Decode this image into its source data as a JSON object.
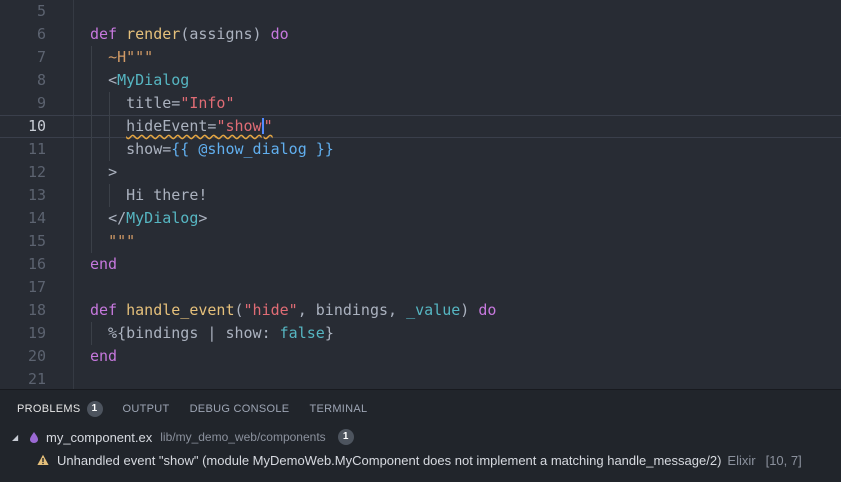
{
  "editor": {
    "lines": [
      {
        "n": "5",
        "tokens": []
      },
      {
        "n": "6",
        "tokens": [
          [
            "kw",
            "def"
          ],
          [
            "txt",
            " "
          ],
          [
            "fn",
            "render"
          ],
          [
            "punct",
            "(assigns) "
          ],
          [
            "kw",
            "do"
          ]
        ]
      },
      {
        "n": "7",
        "tokens": [
          [
            "txt",
            "  "
          ],
          [
            "sigil",
            "~H"
          ],
          [
            "heredoc",
            "\"\"\""
          ]
        ]
      },
      {
        "n": "8",
        "tokens": [
          [
            "txt",
            "  "
          ],
          [
            "punct",
            "<"
          ],
          [
            "comp",
            "MyDialog"
          ]
        ]
      },
      {
        "n": "9",
        "tokens": [
          [
            "txt",
            "    "
          ],
          [
            "attr",
            "title="
          ],
          [
            "val",
            "\"Info\""
          ]
        ]
      },
      {
        "n": "10",
        "tokens": [
          [
            "txt",
            "    "
          ],
          [
            "attr",
            "hideEvent="
          ],
          [
            "val",
            "\"show"
          ],
          [
            "cursor",
            ""
          ],
          [
            "val",
            "\""
          ]
        ]
      },
      {
        "n": "11",
        "tokens": [
          [
            "txt",
            "    "
          ],
          [
            "attr",
            "show="
          ],
          [
            "bind",
            "{{ @show_dialog }}"
          ]
        ]
      },
      {
        "n": "12",
        "tokens": [
          [
            "txt",
            "  "
          ],
          [
            "punct",
            ">"
          ]
        ]
      },
      {
        "n": "13",
        "tokens": [
          [
            "txt",
            "    Hi there!"
          ]
        ]
      },
      {
        "n": "14",
        "tokens": [
          [
            "txt",
            "  "
          ],
          [
            "punct",
            "</"
          ],
          [
            "comp",
            "MyDialog"
          ],
          [
            "punct",
            ">"
          ]
        ]
      },
      {
        "n": "15",
        "tokens": [
          [
            "txt",
            "  "
          ],
          [
            "heredoc",
            "\"\"\""
          ]
        ]
      },
      {
        "n": "16",
        "tokens": [
          [
            "kw",
            "end"
          ]
        ]
      },
      {
        "n": "17",
        "tokens": []
      },
      {
        "n": "18",
        "tokens": [
          [
            "kw",
            "def"
          ],
          [
            "txt",
            " "
          ],
          [
            "fn",
            "handle_event"
          ],
          [
            "punct",
            "("
          ],
          [
            "val",
            "\"hide\""
          ],
          [
            "punct",
            ", bindings, "
          ],
          [
            "under",
            "_value"
          ],
          [
            "punct",
            ") "
          ],
          [
            "kw",
            "do"
          ]
        ]
      },
      {
        "n": "19",
        "tokens": [
          [
            "txt",
            "  %{bindings | show: "
          ],
          [
            "bool",
            "false"
          ],
          [
            "txt",
            "}"
          ]
        ]
      },
      {
        "n": "20",
        "tokens": [
          [
            "kw",
            "end"
          ]
        ]
      },
      {
        "n": "21",
        "tokens": []
      }
    ],
    "active_line": "10"
  },
  "panel": {
    "tabs": [
      {
        "label": "PROBLEMS",
        "badge": "1",
        "active": true
      },
      {
        "label": "OUTPUT"
      },
      {
        "label": "DEBUG CONSOLE"
      },
      {
        "label": "TERMINAL"
      }
    ],
    "file": {
      "name": "my_component.ex",
      "path": "lib/my_demo_web/components",
      "count": "1"
    },
    "diagnostic": {
      "message": "Unhandled event \"show\" (module MyDemoWeb.MyComponent does not implement a matching handle_message/2)",
      "source": "Elixir",
      "position": "[10, 7]"
    }
  },
  "colors": {
    "editor_bg": "#282c34",
    "panel_bg": "#21252b",
    "keyword": "#c678dd",
    "function": "#e5c07b",
    "string": "#e06c75",
    "component": "#56b6c2",
    "warning": "#e5a642",
    "elixir": "#9b6ad4"
  }
}
